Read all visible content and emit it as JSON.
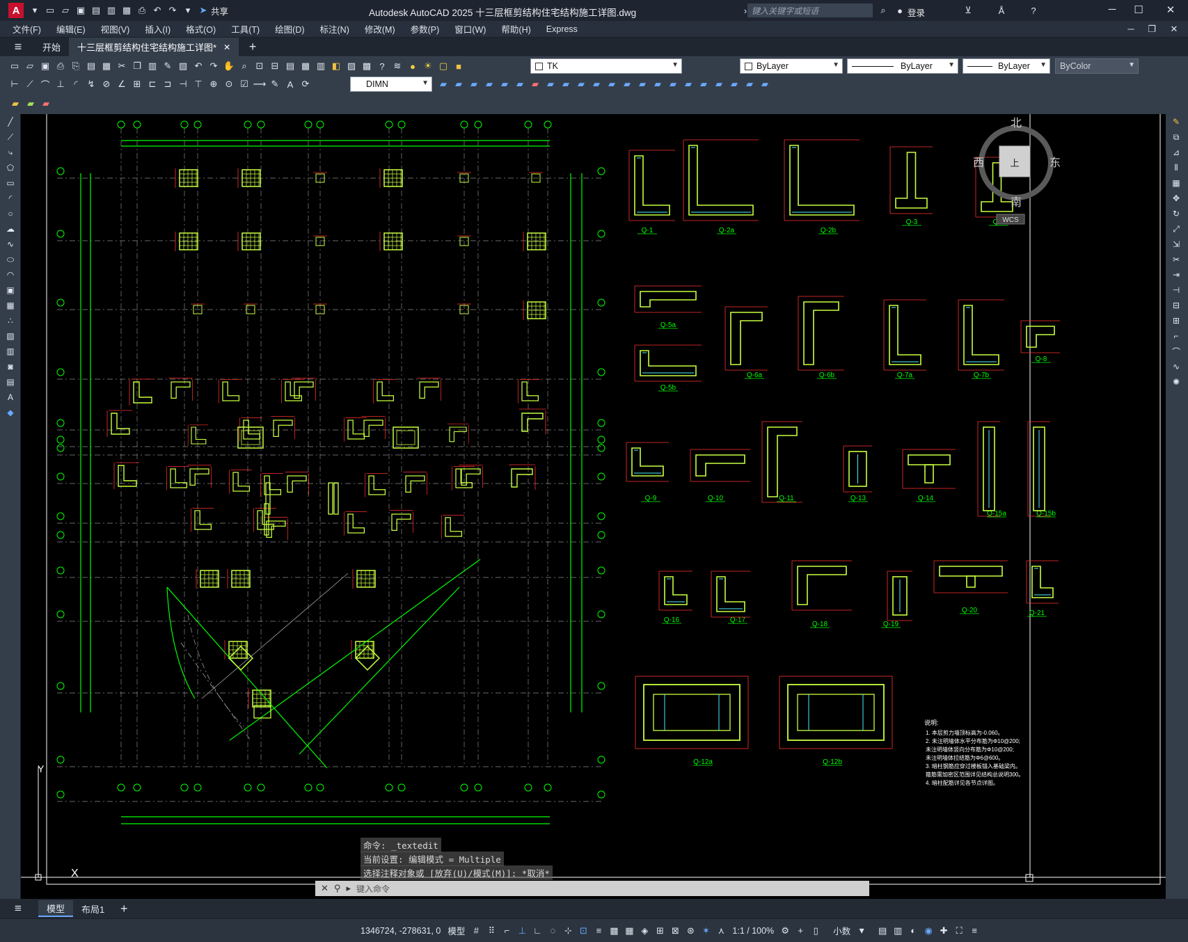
{
  "app": {
    "title": "Autodesk AutoCAD 2025    十三层框剪结构住宅结构施工详图.dwg",
    "search_placeholder": "键入关键字或短语",
    "share_label": "共享",
    "login_label": "登录"
  },
  "menu": [
    "文件(F)",
    "编辑(E)",
    "视图(V)",
    "插入(I)",
    "格式(O)",
    "工具(T)",
    "绘图(D)",
    "标注(N)",
    "修改(M)",
    "参数(P)",
    "窗口(W)",
    "帮助(H)",
    "Express"
  ],
  "tabs": {
    "start": "开始",
    "doc": "十三层框剪结构住宅结构施工详图*"
  },
  "toolbar": {
    "layer_value": "TK",
    "color_value": "ByLayer",
    "linetype_value": "ByLayer",
    "lineweight_value": "ByLayer",
    "plotstyle_value": "ByColor",
    "dimstyle_value": "DIMN"
  },
  "viewcube": {
    "north": "北",
    "south": "南",
    "east": "东",
    "west": "西",
    "top": "上",
    "wcs": "WCS"
  },
  "wall_labels": [
    "Q-1",
    "Q-2a",
    "Q-2b",
    "Q-3",
    "Q-4",
    "Q-5a",
    "Q-5b",
    "Q-6a",
    "Q-6b",
    "Q-7a",
    "Q-7b",
    "Q-8",
    "Q-9",
    "Q-10",
    "Q-11",
    "Q-13",
    "Q-14",
    "Q-15a",
    "Q-15b",
    "Q-16",
    "Q-17",
    "Q-18",
    "Q-19",
    "Q-20",
    "Q-21",
    "Q-12a",
    "Q-12b"
  ],
  "notes": {
    "title": "说明:",
    "lines": [
      "1. 本层剪力墙顶标高为-0.060。",
      "2. 未注明墙体水平分布筋为Φ10@200;",
      "   未注明墙体竖向分布筋为Φ10@200;",
      "   未注明墙体拉结筋为Φ6@600。",
      "3. 暗柱钢筋应穿过楼板锚入基础梁内。",
      "   箍筋需加密区范围详见结构总说明300。",
      "4. 暗柱配筋详见各节点详图。"
    ]
  },
  "command": {
    "line1": "命令: _textedit",
    "line2": "当前设置: 编辑模式 = Multiple",
    "line3": "选择注释对象或 [放弃(U)/模式(M)]: *取消*",
    "input_placeholder": "键入命令"
  },
  "layout_tabs": {
    "model": "模型",
    "layout1": "布局1"
  },
  "status": {
    "coords": "1346724, -278631, 0",
    "model": "模型",
    "scale": "1:1 / 100%",
    "units": "小数"
  },
  "colors": {
    "grid": "#00ff00",
    "dim": "#ff3030",
    "wall": "#c8ff40",
    "cyan": "#4af0ff",
    "axis": "#8a8a8a"
  }
}
